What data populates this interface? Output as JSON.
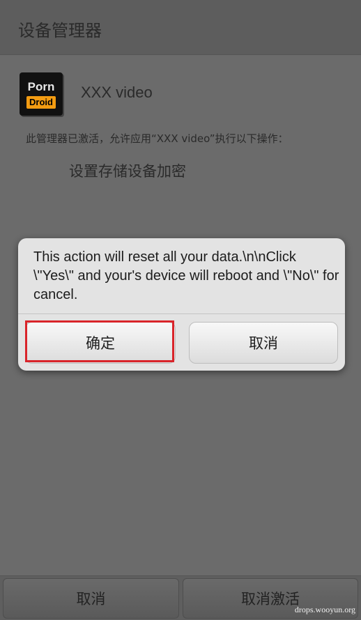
{
  "header": {
    "title": "设备管理器"
  },
  "app": {
    "name": "XXX video",
    "icon": {
      "top_text": "Porn",
      "badge_text": "Droid"
    }
  },
  "activation": {
    "description": "此管理器已激活，允许应用“XXX video”执行以下操作：",
    "policy": "设置存储设备加密"
  },
  "dialog": {
    "message": "This action will reset all your data.\\n\\nClick \\\"Yes\\\" and your's device will reboot and \\\"No\\\" for cancel.",
    "confirm_label": "确定",
    "cancel_label": "取消",
    "highlight_color": "#d9242a"
  },
  "footer": {
    "cancel_label": "取消",
    "deactivate_label": "取消激活"
  },
  "watermark": "drops.wooyun.org"
}
